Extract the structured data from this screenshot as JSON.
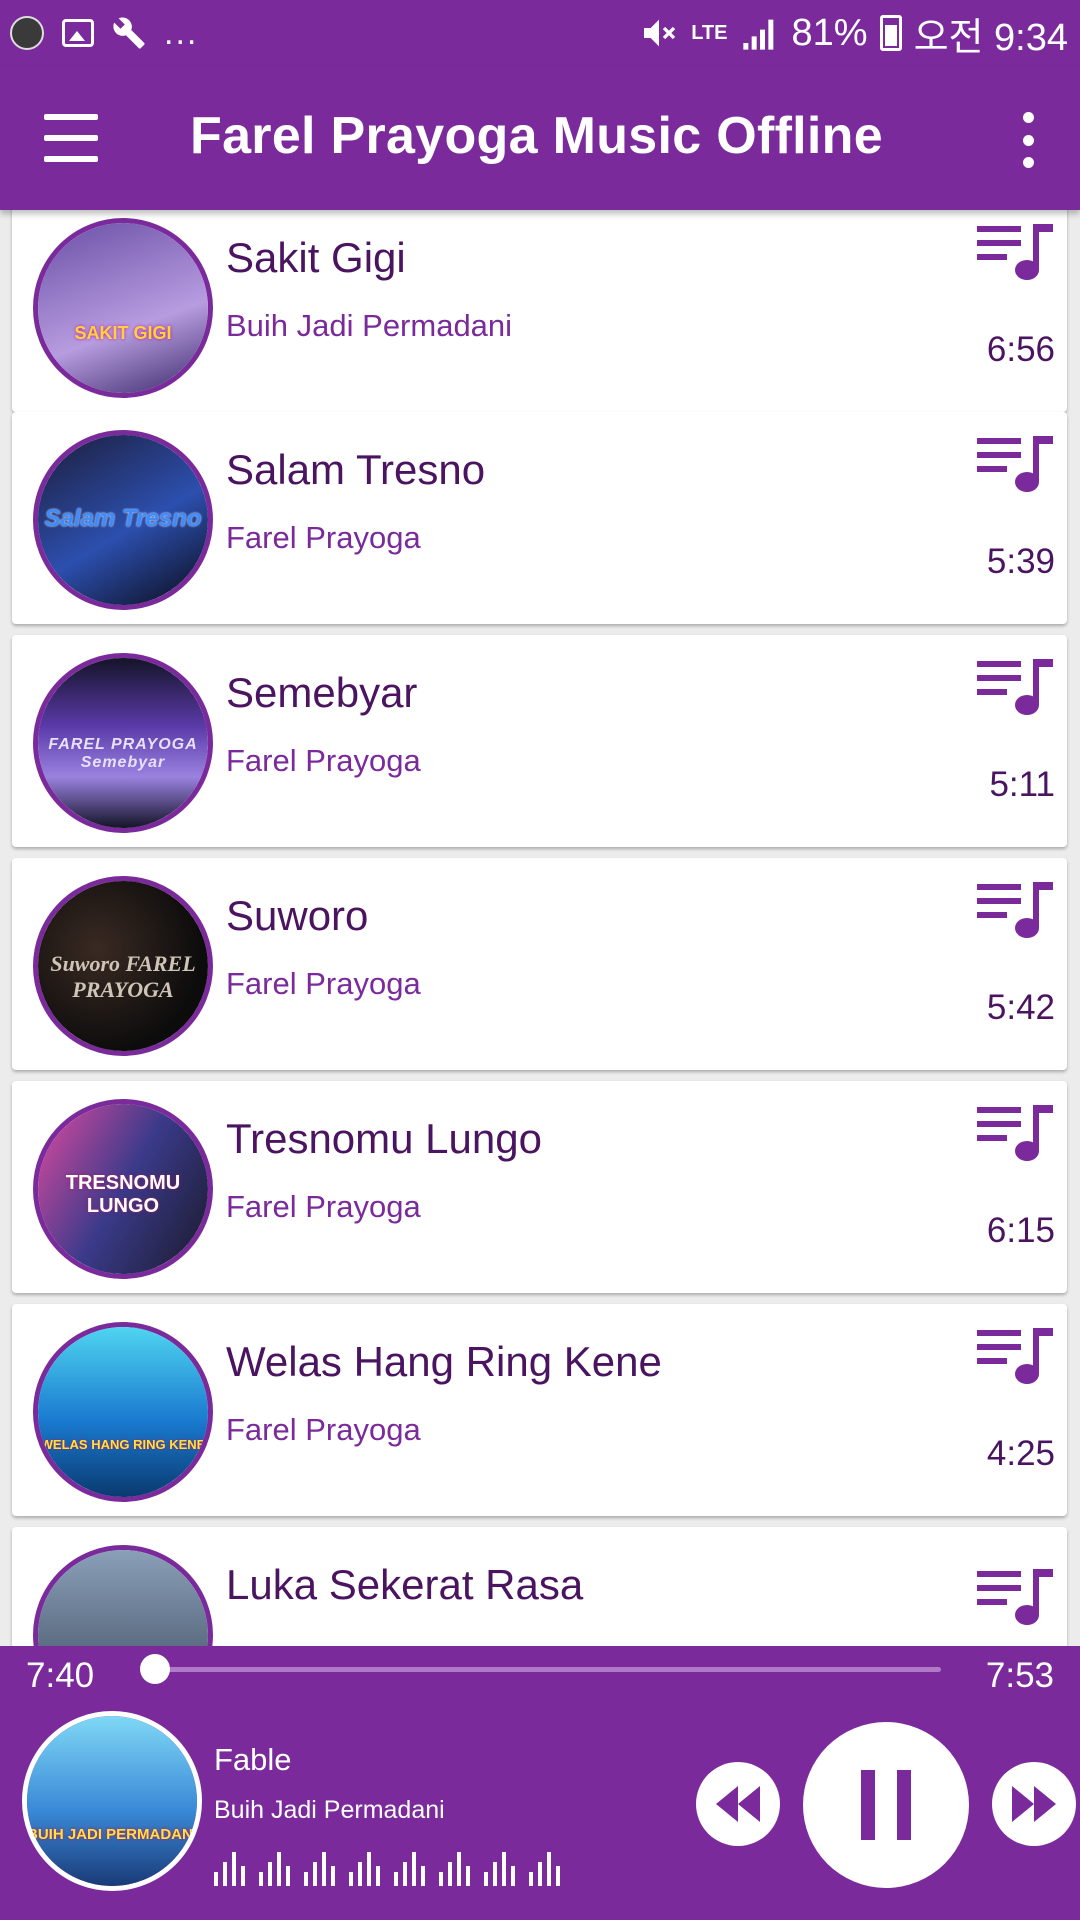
{
  "status_bar": {
    "more_indicator": "...",
    "network": "LTE",
    "battery": "81%",
    "clock": "오전 9:34"
  },
  "app_bar": {
    "title": "Farel Prayoga Music Offline",
    "menu_icon": "hamburger-menu-icon",
    "overflow_icon": "more-vert-icon"
  },
  "songs": [
    {
      "title": "Sakit Gigi",
      "artist": "Buih Jadi Permadani",
      "duration": "6:56",
      "art_text": "SAKIT GIGI"
    },
    {
      "title": "Salam Tresno",
      "artist": "Farel Prayoga",
      "duration": "5:39",
      "art_text": "Salam Tresno"
    },
    {
      "title": "Semebyar",
      "artist": "Farel Prayoga",
      "duration": "5:11",
      "art_text": "FAREL PRAYOGA Semebyar"
    },
    {
      "title": "Suworo",
      "artist": "Farel Prayoga",
      "duration": "5:42",
      "art_text": "Suworo FAREL PRAYOGA"
    },
    {
      "title": "Tresnomu Lungo",
      "artist": "Farel Prayoga",
      "duration": "6:15",
      "art_text": "TRESNOMU LUNGO"
    },
    {
      "title": "Welas Hang Ring Kene",
      "artist": "Farel Prayoga",
      "duration": "4:25",
      "art_text": "WELAS HANG RING KENE"
    },
    {
      "title": "Luka Sekerat Rasa",
      "artist": "",
      "duration": "",
      "art_text": ""
    }
  ],
  "player": {
    "current_time": "7:40",
    "total_time": "7:53",
    "progress_fraction": 0.0,
    "now_playing_title": "Fable",
    "now_playing_artist": "Buih Jadi Permadani",
    "art_text": "BUIH JADI PERMADANI",
    "state": "playing"
  },
  "colors": {
    "primary": "#7b2a9c",
    "title_text": "#4a1460",
    "artist_text": "#7b2a9c"
  }
}
